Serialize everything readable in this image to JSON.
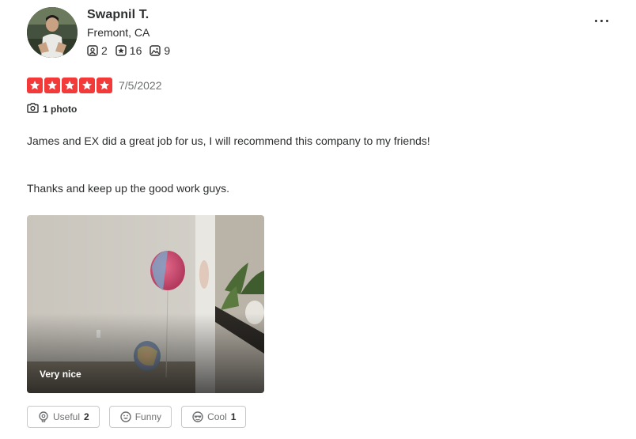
{
  "user": {
    "name": "Swapnil T.",
    "location": "Fremont, CA",
    "stats": {
      "friends": "2",
      "reviews": "16",
      "photos": "9"
    }
  },
  "review": {
    "rating": 5,
    "date": "7/5/2022",
    "photo_count_label": "1 photo",
    "paragraphs": [
      "James and EX did a great job for us, I will recommend this company to my friends!",
      "Thanks and keep up the good work guys."
    ],
    "photo": {
      "caption": "Very nice"
    }
  },
  "reactions": {
    "useful": {
      "label": "Useful",
      "count": "2"
    },
    "funny": {
      "label": "Funny",
      "count": ""
    },
    "cool": {
      "label": "Cool",
      "count": "1"
    }
  },
  "icons": {
    "friends": "friends-icon",
    "reviews": "review-star-icon",
    "photos": "photo-icon",
    "camera": "camera-icon",
    "more": "more-options-icon",
    "useful": "lightbulb-icon",
    "funny": "smiley-icon",
    "cool": "sunglasses-icon"
  },
  "colors": {
    "star_red": "#f43939",
    "text": "#2d2e2f",
    "muted": "#6e7072",
    "border": "#c8c9ca"
  }
}
